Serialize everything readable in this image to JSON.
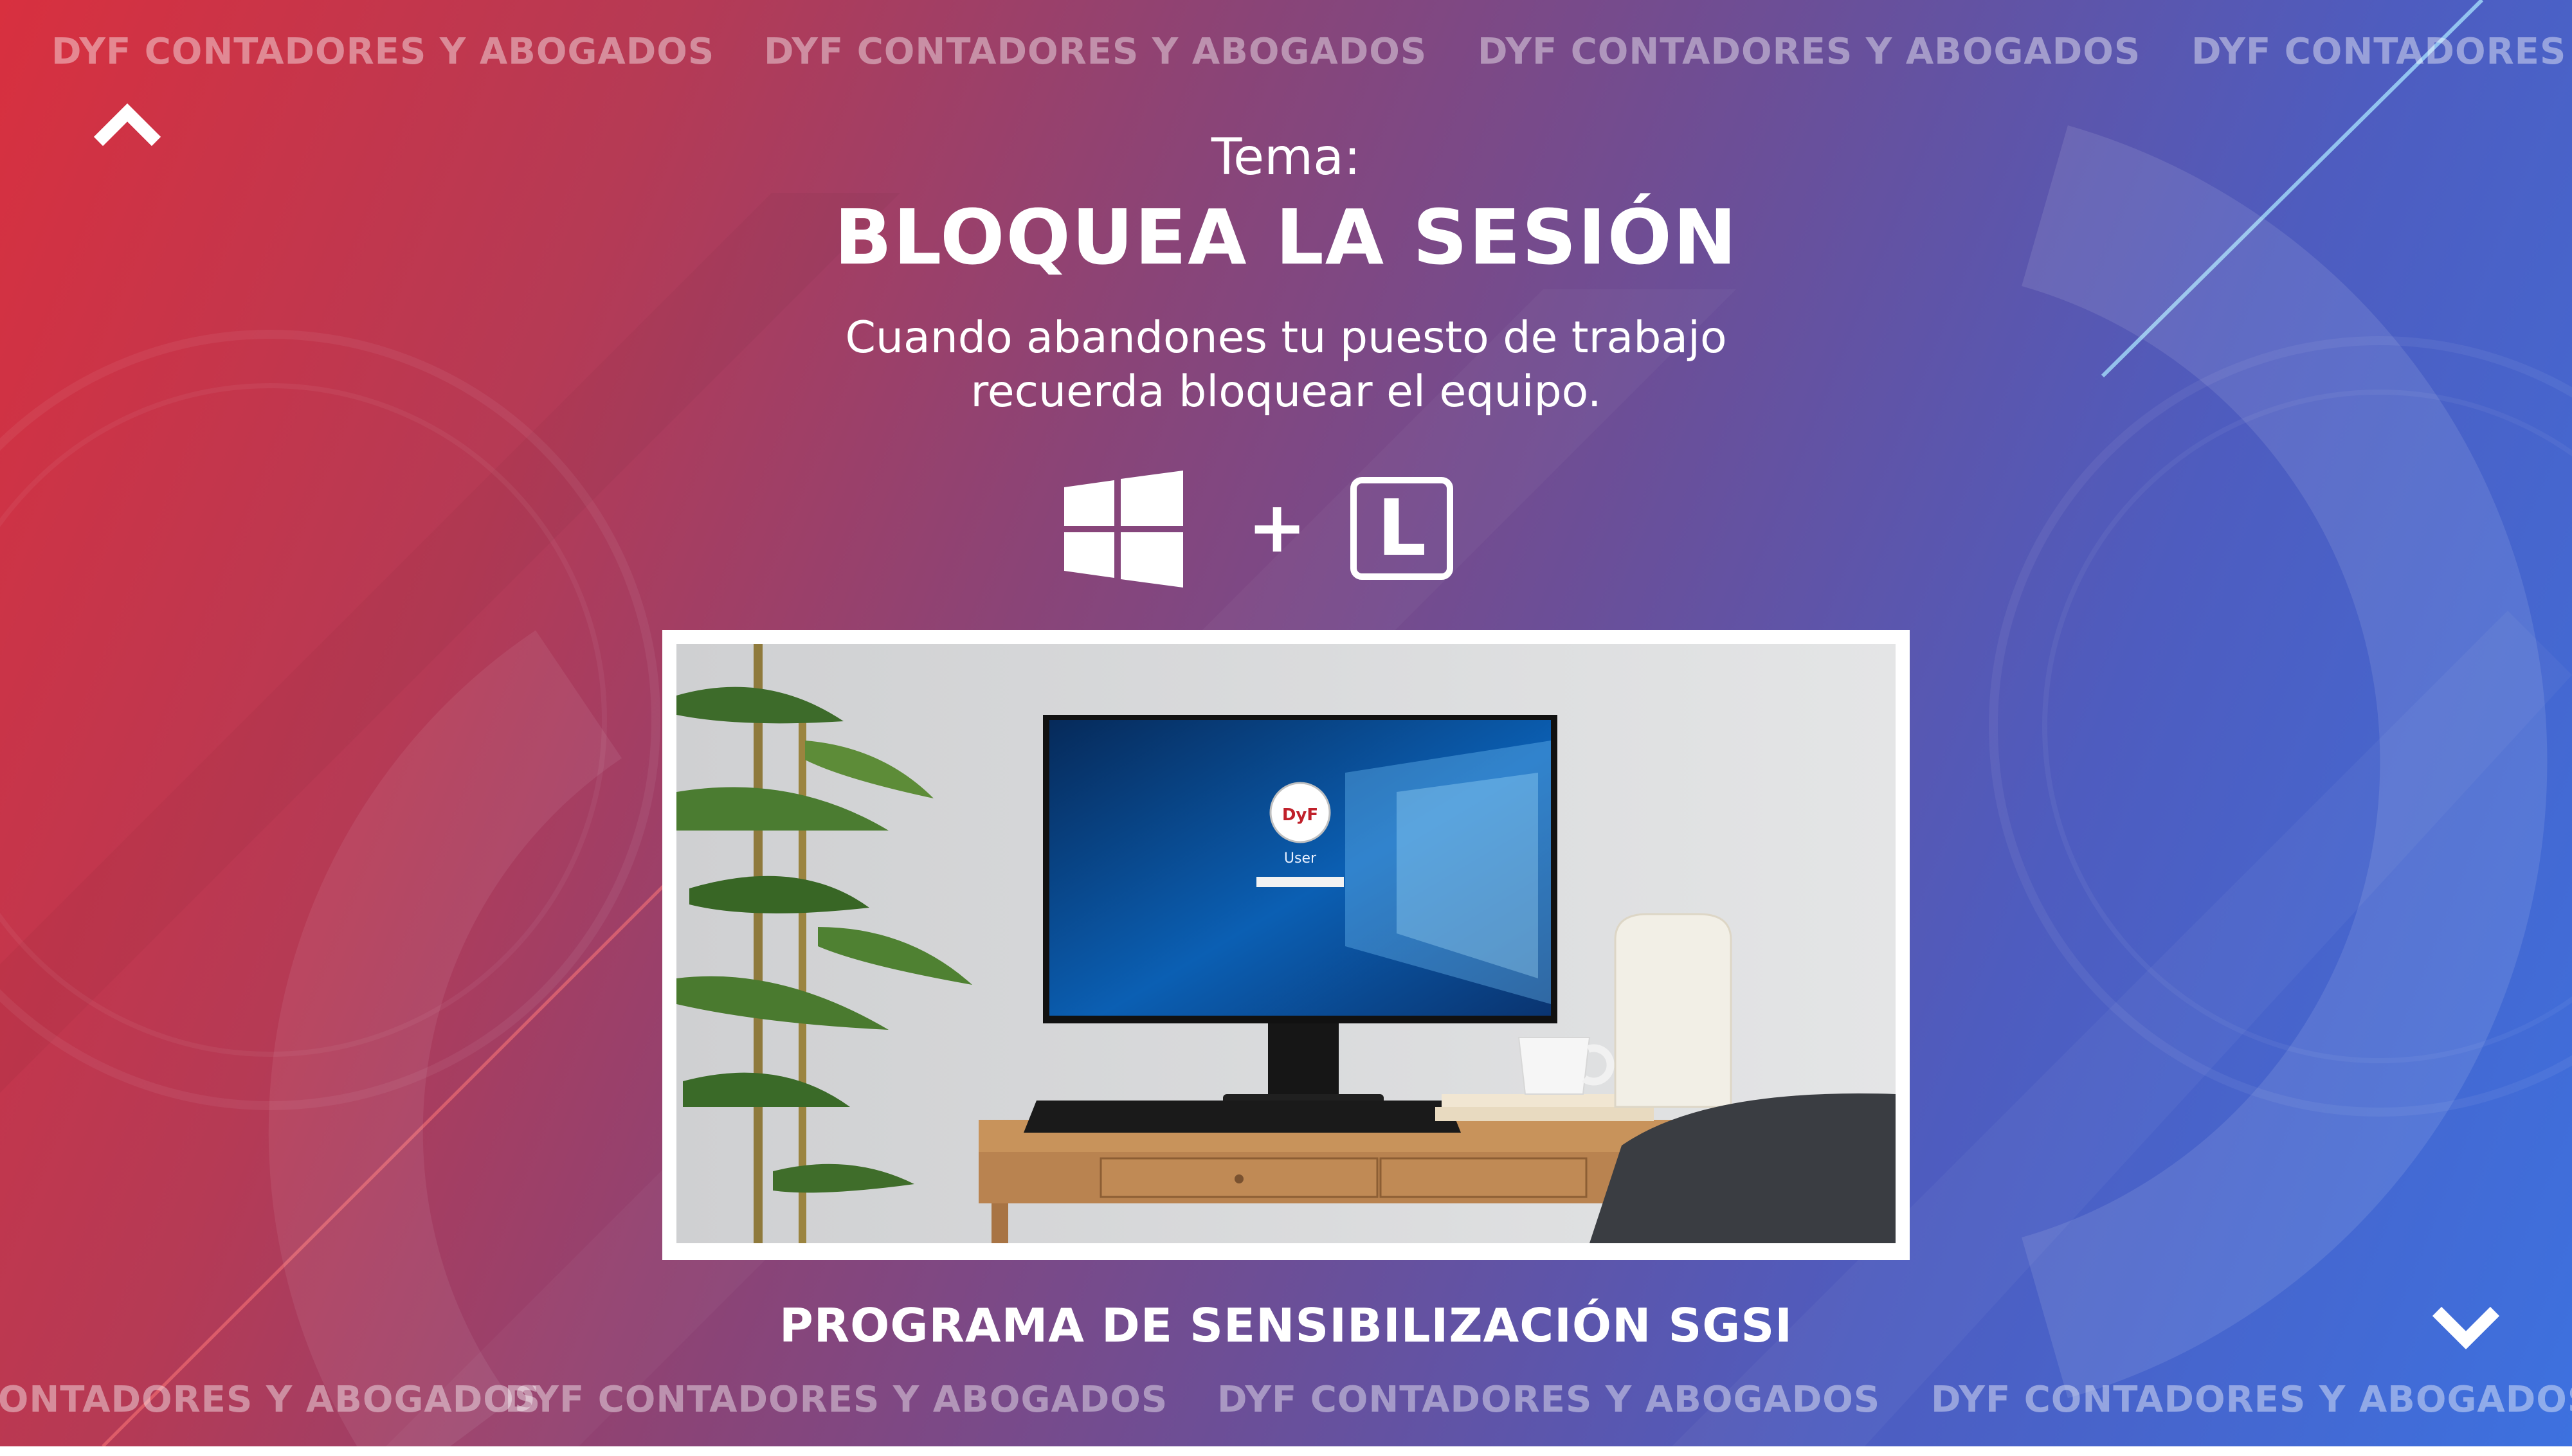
{
  "brand": {
    "ticker_text": "DYF CONTADORES Y ABOGADOS"
  },
  "header": {
    "topic_label": "Tema:",
    "title": "BLOQUEA LA SESIÓN"
  },
  "description": {
    "line1": "Cuando abandones tu puesto de trabajo",
    "line2": "recuerda bloquear el equipo."
  },
  "shortcut": {
    "plus": "+",
    "key": "L",
    "icon": "windows-logo-icon"
  },
  "photo": {
    "login_user": "User",
    "logo_text": "DyF"
  },
  "footer": {
    "program": "PROGRAMA DE SENSIBILIZACIÓN SGSI"
  },
  "nav": {
    "up_icon": "chevron-up-icon",
    "down_icon": "chevron-down-icon"
  },
  "colors": {
    "red": "#d8303f",
    "purple": "#8a4477",
    "blue": "#3d71df",
    "frame": "#ffffff"
  }
}
